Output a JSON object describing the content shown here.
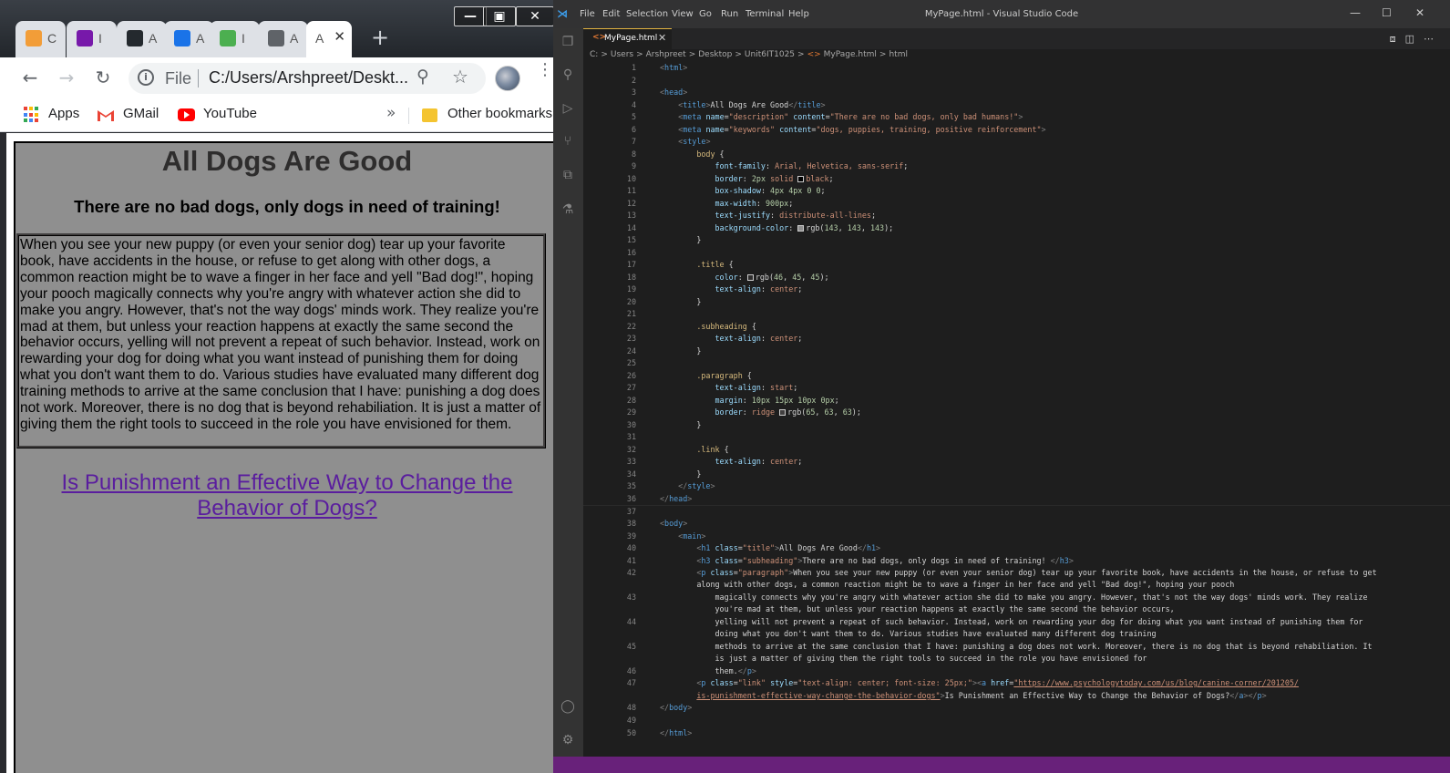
{
  "browser": {
    "tabs": [
      {
        "label": "C",
        "icon": "pencil-icon",
        "color": "#f29d38"
      },
      {
        "label": "I",
        "icon": "onenote-icon",
        "color": "#7719aa"
      },
      {
        "label": "A",
        "icon": "github-icon",
        "color": "#24292e"
      },
      {
        "label": "A",
        "icon": "coffee-icon",
        "color": "#1a73e8"
      },
      {
        "label": "I",
        "icon": "w3schools-icon",
        "color": "#4caf50"
      },
      {
        "label": "A",
        "icon": "globe-icon",
        "color": "#5f6368"
      },
      {
        "label": "A",
        "icon": "page-icon",
        "color": "#5f6368"
      }
    ],
    "window_controls": {
      "minimize": "—",
      "restore": "▣",
      "close": "✕"
    },
    "address": {
      "info": "i",
      "scheme": "File",
      "url": "C:/Users/Arshpreet/Deskt..."
    },
    "bookmarks": [
      "Apps",
      "GMail",
      "YouTube",
      "Other bookmarks"
    ],
    "bookmarks_more": "»",
    "new_tab": "+"
  },
  "webpage": {
    "title": "All Dogs Are Good",
    "subheading": "There are no bad dogs, only dogs in need of training!",
    "paragraph": "When you see your new puppy (or even your senior dog) tear up your favorite book, have accidents in the house, or refuse to get along with other dogs, a common reaction might be to wave a finger in her face and yell \"Bad dog!\", hoping your pooch magically connects why you're angry with whatever action she did to make you angry. However, that's not the way dogs' minds work. They realize you're mad at them, but unless your reaction happens at exactly the same second the behavior occurs, yelling will not prevent a repeat of such behavior. Instead, work on rewarding your dog for doing what you want instead of punishing them for doing what you don't want them to do. Various studies have evaluated many different dog training methods to arrive at the same conclusion that I have: punishing a dog does not work. Moreover, there is no dog that is beyond rehabiliation. It is just a matter of giving them the right tools to succeed in the role you have envisioned for them.",
    "link_text": "Is Punishment an Effective Way to Change the Behavior of Dogs?"
  },
  "vscode": {
    "menu": [
      "File",
      "Edit",
      "Selection",
      "View",
      "Go",
      "Run",
      "Terminal",
      "Help"
    ],
    "window_title": "MyPage.html - Visual Studio Code",
    "tab_label": "MyPage.html",
    "breadcrumb": [
      "C:",
      ">",
      "Users",
      ">",
      "Arshpreet",
      ">",
      "Desktop",
      ">",
      "Unit6IT1025",
      ">",
      "<>",
      "MyPage.html",
      ">",
      "html"
    ],
    "accent_color": "#68217a"
  }
}
